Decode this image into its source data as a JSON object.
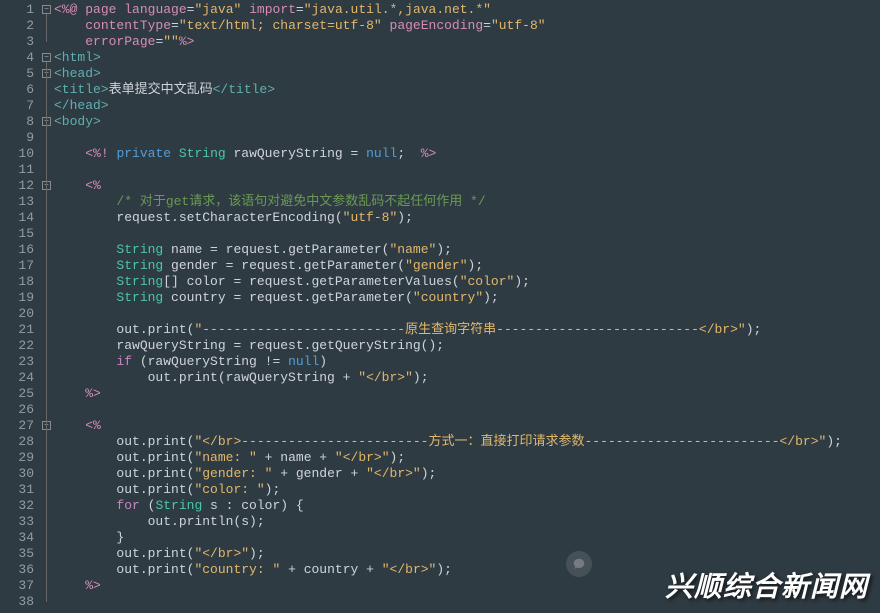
{
  "watermark": "兴顺综合新闻网",
  "lines": [
    {
      "n": 1,
      "fold": "minus",
      "html": "<span class='pink'>&lt;%@</span> <span class='pink'>page</span> <span class='pink'>language</span><span class='op'>=</span><span class='str'>\"java\"</span> <span class='pink'>import</span><span class='op'>=</span><span class='str'>\"java.util.*,java.net.*\"</span>"
    },
    {
      "n": 2,
      "html": "    <span class='pink'>contentType</span><span class='op'>=</span><span class='str'>\"text/html; charset=utf-8\"</span> <span class='pink'>pageEncoding</span><span class='op'>=</span><span class='str'>\"utf-8\"</span>"
    },
    {
      "n": 3,
      "html": "    <span class='pink'>errorPage</span><span class='op'>=</span><span class='str'>\"\"</span><span class='pink'>%&gt;</span>"
    },
    {
      "n": 4,
      "fold": "minus",
      "html": "<span class='tag'>&lt;html&gt;</span>"
    },
    {
      "n": 5,
      "fold": "minus",
      "html": "<span class='tag'>&lt;head&gt;</span>"
    },
    {
      "n": 6,
      "html": "<span class='tag'>&lt;title&gt;</span>表单提交中文乱码<span class='tag'>&lt;/title&gt;</span>"
    },
    {
      "n": 7,
      "html": "<span class='tag'>&lt;/head&gt;</span>"
    },
    {
      "n": 8,
      "fold": "minus",
      "html": "<span class='tag'>&lt;body&gt;</span>"
    },
    {
      "n": 9,
      "html": ""
    },
    {
      "n": 10,
      "html": "    <span class='pink'>&lt;%!</span> <span class='kw'>private</span> <span class='type'>String</span> rawQueryString <span class='op'>=</span> <span class='kw'>null</span>;  <span class='pink'>%&gt;</span>"
    },
    {
      "n": 11,
      "html": ""
    },
    {
      "n": 12,
      "fold": "minus",
      "html": "    <span class='pink'>&lt;%</span>"
    },
    {
      "n": 13,
      "html": "        <span class='comment'>/* 对于get请求，该语句对避免中文参数乱码不起任何作用 */</span>"
    },
    {
      "n": 14,
      "html": "        request.setCharacterEncoding(<span class='str'>\"utf-8\"</span>);"
    },
    {
      "n": 15,
      "html": ""
    },
    {
      "n": 16,
      "html": "        <span class='type'>String</span> name <span class='op'>=</span> request.getParameter(<span class='str'>\"name\"</span>);"
    },
    {
      "n": 17,
      "html": "        <span class='type'>String</span> gender <span class='op'>=</span> request.getParameter(<span class='str'>\"gender\"</span>);"
    },
    {
      "n": 18,
      "html": "        <span class='type'>String</span>[] color <span class='op'>=</span> request.getParameterValues(<span class='str'>\"color\"</span>);"
    },
    {
      "n": 19,
      "html": "        <span class='type'>String</span> country <span class='op'>=</span> request.getParameter(<span class='str'>\"country\"</span>);"
    },
    {
      "n": 20,
      "html": ""
    },
    {
      "n": 21,
      "html": "        out.print(<span class='str'>\"--------------------------原生查询字符串--------------------------&lt;/br&gt;\"</span>);"
    },
    {
      "n": 22,
      "html": "        rawQueryString <span class='op'>=</span> request.getQueryString();"
    },
    {
      "n": 23,
      "html": "        <span class='purple'>if</span> (rawQueryString <span class='op'>!=</span> <span class='kw'>null</span>)"
    },
    {
      "n": 24,
      "html": "            out.print(rawQueryString <span class='op'>+</span> <span class='str'>\"&lt;/br&gt;\"</span>);"
    },
    {
      "n": 25,
      "html": "    <span class='pink'>%&gt;</span>"
    },
    {
      "n": 26,
      "html": ""
    },
    {
      "n": 27,
      "fold": "minus",
      "html": "    <span class='pink'>&lt;%</span>"
    },
    {
      "n": 28,
      "html": "        out.print(<span class='str'>\"&lt;/br&gt;------------------------方式一：直接打印请求参数-------------------------&lt;/br&gt;\"</span>);"
    },
    {
      "n": 29,
      "html": "        out.print(<span class='str'>\"name: \"</span> <span class='op'>+</span> name <span class='op'>+</span> <span class='str'>\"&lt;/br&gt;\"</span>);"
    },
    {
      "n": 30,
      "html": "        out.print(<span class='str'>\"gender: \"</span> <span class='op'>+</span> gender <span class='op'>+</span> <span class='str'>\"&lt;/br&gt;\"</span>);"
    },
    {
      "n": 31,
      "html": "        out.print(<span class='str'>\"color: \"</span>);"
    },
    {
      "n": 32,
      "html": "        <span class='purple'>for</span> (<span class='type'>String</span> s : color) {"
    },
    {
      "n": 33,
      "html": "            out.println(s);"
    },
    {
      "n": 34,
      "html": "        }"
    },
    {
      "n": 35,
      "html": "        out.print(<span class='str'>\"&lt;/br&gt;\"</span>);"
    },
    {
      "n": 36,
      "html": "        out.print(<span class='str'>\"country: \"</span> <span class='op'>+</span> country <span class='op'>+</span> <span class='str'>\"&lt;/br&gt;\"</span>);"
    },
    {
      "n": 37,
      "html": "    <span class='pink'>%&gt;</span>"
    },
    {
      "n": 38,
      "html": ""
    }
  ]
}
